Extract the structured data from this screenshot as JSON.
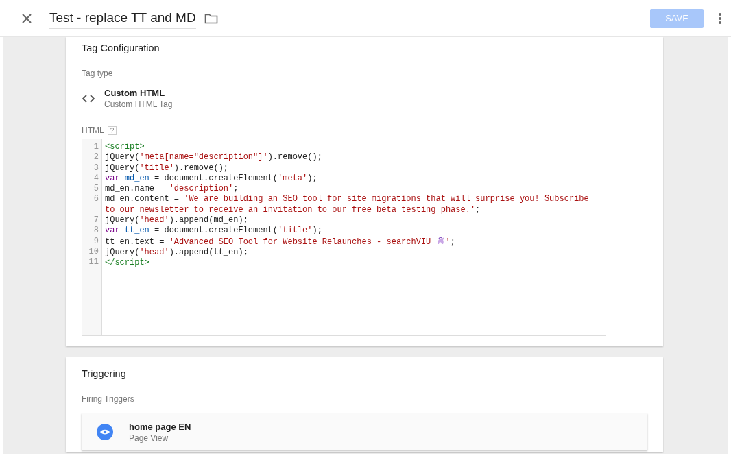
{
  "header": {
    "title": "Test - replace TT and MD",
    "save_button": {
      "label": "SAVE",
      "disabled": true
    }
  },
  "tag_configuration": {
    "title": "Tag Configuration",
    "tag_type_label": "Tag type",
    "tag_type": {
      "name": "Custom HTML",
      "description": "Custom HTML Tag"
    },
    "html_label": "HTML",
    "help_badge": "?",
    "code_lines": [
      {
        "num": "1",
        "tokens": [
          {
            "kind": "tag",
            "text": "<script>"
          }
        ]
      },
      {
        "num": "2",
        "tokens": [
          {
            "kind": "plain",
            "text": "jQuery("
          },
          {
            "kind": "string",
            "text": "'meta[name=\"description\"]'"
          },
          {
            "kind": "plain",
            "text": ").remove();"
          }
        ]
      },
      {
        "num": "3",
        "tokens": [
          {
            "kind": "plain",
            "text": "jQuery("
          },
          {
            "kind": "string",
            "text": "'title'"
          },
          {
            "kind": "plain",
            "text": ").remove();"
          }
        ]
      },
      {
        "num": "4",
        "tokens": [
          {
            "kind": "keyword",
            "text": "var "
          },
          {
            "kind": "variable",
            "text": "md_en"
          },
          {
            "kind": "plain",
            "text": " = document.createElement("
          },
          {
            "kind": "string",
            "text": "'meta'"
          },
          {
            "kind": "plain",
            "text": ");"
          }
        ]
      },
      {
        "num": "5",
        "tokens": [
          {
            "kind": "plain",
            "text": "md_en.name = "
          },
          {
            "kind": "string",
            "text": "'description'"
          },
          {
            "kind": "plain",
            "text": ";"
          }
        ]
      },
      {
        "num": "6",
        "tokens": [
          {
            "kind": "plain",
            "text": "md_en.content = "
          },
          {
            "kind": "string",
            "text": "'We are building an SEO tool for site migrations that will surprise you! Subscribe to our newsletter to receive an invitation to our free beta testing phase.'"
          },
          {
            "kind": "plain",
            "text": ";"
          }
        ]
      },
      {
        "num": "7",
        "tokens": [
          {
            "kind": "plain",
            "text": "jQuery("
          },
          {
            "kind": "string",
            "text": "'head'"
          },
          {
            "kind": "plain",
            "text": ").append(md_en);"
          }
        ]
      },
      {
        "num": "8",
        "tokens": [
          {
            "kind": "keyword",
            "text": "var "
          },
          {
            "kind": "variable",
            "text": "tt_en"
          },
          {
            "kind": "plain",
            "text": " = document.createElement("
          },
          {
            "kind": "string",
            "text": "'title'"
          },
          {
            "kind": "plain",
            "text": ");"
          }
        ]
      },
      {
        "num": "9",
        "tokens": [
          {
            "kind": "plain",
            "text": "tt_en.text = "
          },
          {
            "kind": "string",
            "text": "'Advanced SEO Tool for Website Relaunches - searchVIU "
          },
          {
            "kind": "emoji"
          },
          {
            "kind": "string",
            "text": "'"
          },
          {
            "kind": "plain",
            "text": ";"
          }
        ]
      },
      {
        "num": "10",
        "tokens": [
          {
            "kind": "plain",
            "text": "jQuery("
          },
          {
            "kind": "string",
            "text": "'head'"
          },
          {
            "kind": "plain",
            "text": ").append(tt_en);"
          }
        ]
      },
      {
        "num": "11",
        "tokens": [
          {
            "kind": "tag",
            "text": "</script>"
          }
        ]
      }
    ]
  },
  "triggering": {
    "title": "Triggering",
    "firing_label": "Firing Triggers",
    "triggers": [
      {
        "name": "home page EN",
        "type": "Page View"
      }
    ]
  }
}
